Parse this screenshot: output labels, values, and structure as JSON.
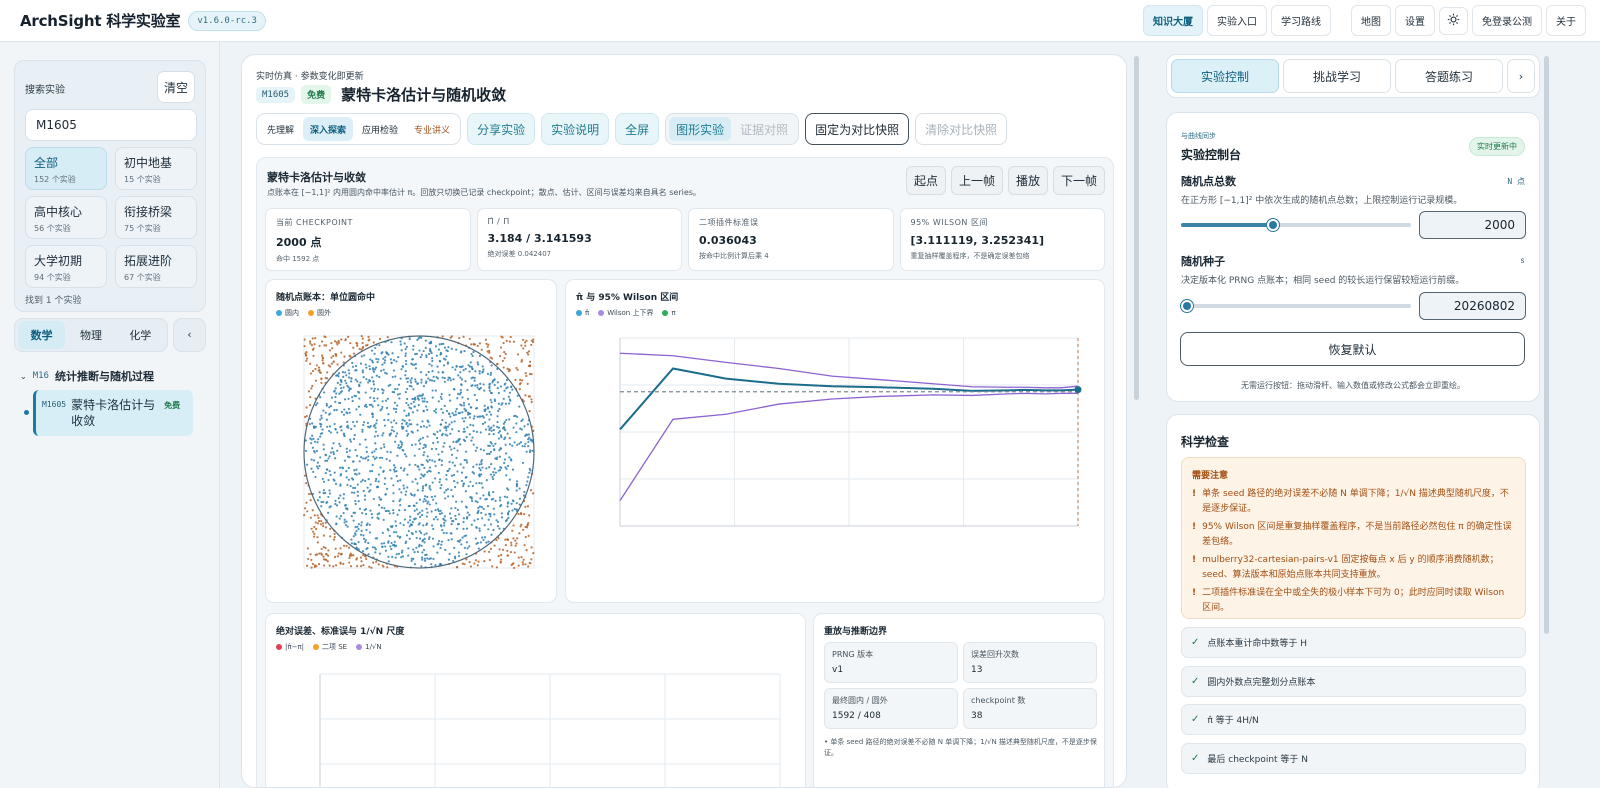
{
  "header": {
    "brand": "ArchSight 科学实验室",
    "version": "v1.6.0-rc.3",
    "nav": [
      "知识大厦",
      "实验入口",
      "学习路线"
    ],
    "nav2": [
      "地图",
      "设置"
    ],
    "login": "免登录公测",
    "about": "关于"
  },
  "sidebar": {
    "search_label": "搜索实验",
    "clear": "清空",
    "search_value": "M1605",
    "filters": [
      {
        "name": "全部",
        "count": "152 个实验"
      },
      {
        "name": "初中地基",
        "count": "15 个实验"
      },
      {
        "name": "高中核心",
        "count": "56 个实验"
      },
      {
        "name": "衔接桥梁",
        "count": "75 个实验"
      },
      {
        "name": "大学初期",
        "count": "94 个实验"
      },
      {
        "name": "拓展进阶",
        "count": "67 个实验"
      }
    ],
    "found": "找到 1 个实验",
    "subjects": [
      "数学",
      "物理",
      "化学"
    ],
    "collapse": "‹",
    "group_code": "M16",
    "group_name": "统计推断与随机过程",
    "item_code": "M1605",
    "item_title": "蒙特卡洛估计与收敛",
    "item_free": "免费"
  },
  "main": {
    "crumb": "实时仿真 · 参数变化即更新",
    "code": "M1605",
    "free": "免费",
    "title": "蒙特卡洛估计与随机收敛",
    "modes": [
      "先理解",
      "深入探索",
      "应用检验",
      "专业讲义"
    ],
    "share": "分享实验",
    "explain": "实验说明",
    "fullscreen": "全屏",
    "view_graph": "图形实验",
    "view_proof": "证据对照",
    "snapshot": "固定为对比快照",
    "clear_snapshot": "清除对比快照",
    "sim_title": "蒙特卡洛估计与收敛",
    "sim_desc": "点账本在 [−1,1]² 内用圆内命中率估计 π。回放只切换已记录 checkpoint；散点、估计、区间与误差均来自具名 series。",
    "playback": [
      "起点",
      "上一帧",
      "播放",
      "下一帧"
    ],
    "stats": [
      {
        "label": "当前 CHECKPOINT",
        "value": "2000 点",
        "note": "命中 1592 点"
      },
      {
        "label": "Π̂ / Π",
        "value": "3.184 / 3.141593",
        "note": "绝对误差 0.042407"
      },
      {
        "label": "二项插件标准误",
        "value": "0.036043",
        "note": "按命中比例计算后乘 4"
      },
      {
        "label": "95% WILSON 区间",
        "value": "[3.111119, 3.252341]",
        "note": "重复抽样覆盖程序，不是确定误差包络"
      }
    ],
    "scatter_title": "随机点账本：单位圆命中",
    "scatter_legend": [
      "圆内",
      "圆外"
    ],
    "conv_title": "π̂ 与 95% Wilson 区间",
    "conv_legend": [
      "π̂",
      "Wilson 上下界",
      "π"
    ],
    "err_title": "绝对误差、标准误与 1/√N 尺度",
    "err_legend": [
      "|π̂−π|",
      "二项 SE",
      "1/√N"
    ],
    "replay_title": "重放与推断边界",
    "replay_kv": [
      {
        "k": "PRNG 版本",
        "v": "v1"
      },
      {
        "k": "误差回升次数",
        "v": "13"
      },
      {
        "k": "最终圆内 / 圆外",
        "v": "1592 / 408"
      },
      {
        "k": "checkpoint 数",
        "v": "38"
      }
    ],
    "replay_note": "• 单条 seed 路径的绝对误差不必随 N 单调下降；1/√N 描述典型随机尺度，不是逐步保证。"
  },
  "right": {
    "tabs": [
      "实验控制",
      "挑战学习",
      "答题练习"
    ],
    "more": "›",
    "kicker": "与曲线同步",
    "ctrl_title": "实验控制台",
    "realtime": "实时更新中",
    "p1_name": "随机点总数",
    "p1_sym": "N 点",
    "p1_desc": "在正方形 [−1,1]² 中依次生成的随机点总数；上限控制运行记录规模。",
    "p1_value": "2000",
    "p1_level": 0.4,
    "p2_name": "随机种子",
    "p2_sym": "s",
    "p2_desc": "决定版本化 PRNG 点账本；相同 seed 的较长运行保留较短运行前缀。",
    "p2_value": "20260802",
    "p2_level": 0.0,
    "reset": "恢复默认",
    "foot": "无需运行按钮：拖动滑杆、输入数值或修改公式都会立即重绘。",
    "sci_title": "科学检查",
    "warn_title": "需要注意",
    "warnings": [
      "单条 seed 路径的绝对误差不必随 N 单调下降；1/√N 描述典型随机尺度，不是逐步保证。",
      "95% Wilson 区间是重复抽样覆盖程序，不是当前路径必然包住 π 的确定性误差包络。",
      "mulberry32-cartesian-pairs-v1 固定按每点 x 后 y 的顺序消费随机数；seed、算法版本和原始点账本共同支持重放。",
      "二项插件标准误在全中或全失的极小样本下可为 0；此时应同时读取 Wilson 区间。"
    ],
    "checks": [
      "点账本重计命中数等于 H",
      "圆内外数点完整划分点账本",
      "π̂ 等于 4H/N",
      "最后 checkpoint 等于 N"
    ]
  },
  "chart_data": [
    {
      "type": "scatter",
      "title": "随机点账本：单位圆命中",
      "series": [
        {
          "name": "圆内",
          "count": 1592
        },
        {
          "name": "圆外",
          "count": 408
        }
      ],
      "xlim": [
        -1,
        1
      ],
      "ylim": [
        -1,
        1
      ]
    },
    {
      "type": "line",
      "title": "π̂ 与 95% Wilson 区间",
      "x": [
        5,
        10,
        20,
        40,
        80,
        150,
        300,
        500,
        800,
        1000,
        1300,
        1600,
        2000
      ],
      "series": [
        {
          "name": "π̂",
          "values": [
            2.4,
            3.6,
            3.4,
            3.3,
            3.25,
            3.23,
            3.2,
            3.16,
            3.17,
            3.18,
            3.17,
            3.17,
            3.184
          ]
        },
        {
          "name": "Wilson 上下界",
          "values": [
            3.9,
            3.85,
            3.72,
            3.6,
            3.45,
            3.38,
            3.3,
            3.24,
            3.23,
            3.23,
            3.22,
            3.22,
            3.252
          ]
        },
        {
          "name": "Wilson 上下界",
          "values": [
            1.0,
            2.6,
            2.7,
            2.9,
            3.0,
            3.05,
            3.08,
            3.07,
            3.1,
            3.11,
            3.1,
            3.11,
            3.111
          ]
        },
        {
          "name": "π",
          "values": [
            3.141593,
            3.141593,
            3.141593,
            3.141593,
            3.141593,
            3.141593,
            3.141593,
            3.141593,
            3.141593,
            3.141593,
            3.141593,
            3.141593,
            3.141593
          ]
        }
      ],
      "ylim": [
        0.5,
        4.2
      ]
    },
    {
      "type": "line",
      "title": "绝对误差、标准误与 1/√N 尺度",
      "series": [
        {
          "name": "|π̂−π|"
        },
        {
          "name": "二项 SE"
        },
        {
          "name": "1/√N"
        }
      ]
    }
  ],
  "colors": {
    "accent": "#1b7aa0",
    "inside": "#2f7fb0",
    "outside": "#b5632a",
    "wilson": "#8c63d0",
    "pi": "#2cae5b",
    "warn": "#a24f12"
  }
}
